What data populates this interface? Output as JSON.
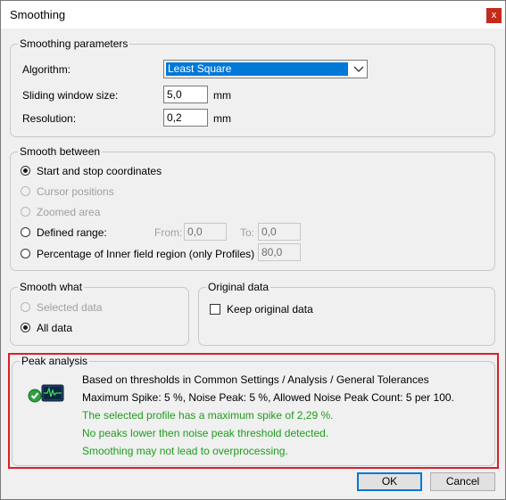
{
  "window": {
    "title": "Smoothing",
    "close_glyph": "x"
  },
  "params": {
    "legend": "Smoothing parameters",
    "algorithm_label": "Algorithm:",
    "algorithm_value": "Least Square",
    "window_label": "Sliding window size:",
    "window_value": "5,0",
    "window_unit": "mm",
    "resolution_label": "Resolution:",
    "resolution_value": "0,2",
    "resolution_unit": "mm"
  },
  "between": {
    "legend": "Smooth between",
    "opt_start_stop": "Start and stop coordinates",
    "opt_cursor": "Cursor positions",
    "opt_zoomed": "Zoomed area",
    "opt_defined": "Defined range:",
    "from_label": "From:",
    "from_value": "0,0",
    "to_label": "To:",
    "to_value": "0,0",
    "opt_percentage": "Percentage of Inner field region (only Profiles)",
    "percentage_value": "80,0"
  },
  "what": {
    "legend": "Smooth what",
    "opt_selected": "Selected data",
    "opt_all": "All data"
  },
  "original": {
    "legend": "Original data",
    "keep_label": "Keep original data"
  },
  "peak": {
    "legend": "Peak analysis",
    "line1": "Based on thresholds in Common Settings / Analysis / General Tolerances",
    "line2": "Maximum Spike: 5 %, Noise Peak: 5 %, Allowed Noise Peak Count: 5 per 100.",
    "line3": "The selected profile has a maximum spike of 2,29 %.",
    "line4": "No peaks lower then noise peak threshold detected.",
    "line5": "Smoothing may not lead to overprocessing."
  },
  "buttons": {
    "ok": "OK",
    "cancel": "Cancel"
  },
  "colors": {
    "accent": "#0078d7",
    "ok_green": "#1e9c1e",
    "highlight_red": "#d9202a",
    "close_red": "#c42b1c"
  }
}
